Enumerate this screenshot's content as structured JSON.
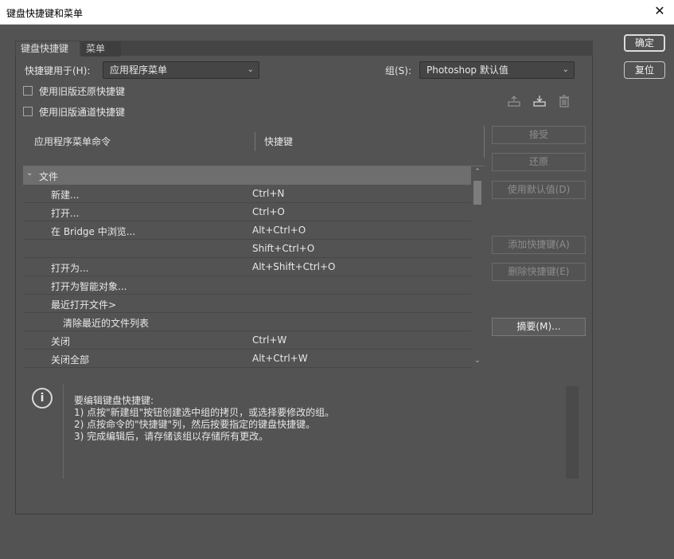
{
  "window": {
    "title": "键盘快捷键和菜单",
    "close_glyph": "✕"
  },
  "tabs": [
    {
      "label": "键盘快捷键"
    },
    {
      "label": "菜单"
    }
  ],
  "shortcuts_for": {
    "label": "快捷键用于(H):",
    "value": "应用程序菜单"
  },
  "set": {
    "label": "组(S):",
    "value": "Photoshop 默认值"
  },
  "checkboxes": [
    {
      "label": "使用旧版还原快捷键",
      "checked": false
    },
    {
      "label": "使用旧版通道快捷键",
      "checked": false
    }
  ],
  "icons": [
    "save-set-icon",
    "new-set-icon",
    "delete-set-icon"
  ],
  "table": {
    "col_command": "应用程序菜单命令",
    "col_shortcut": "快捷键",
    "group": "文件",
    "rows": [
      {
        "cmd": "新建...",
        "key": "Ctrl+N",
        "indent": 1
      },
      {
        "cmd": "打开...",
        "key": "Ctrl+O",
        "indent": 1
      },
      {
        "cmd": "在 Bridge 中浏览...",
        "key": "Alt+Ctrl+O",
        "indent": 1
      },
      {
        "cmd": "",
        "key": "Shift+Ctrl+O",
        "indent": 1
      },
      {
        "cmd": "打开为...",
        "key": "Alt+Shift+Ctrl+O",
        "indent": 1
      },
      {
        "cmd": "打开为智能对象...",
        "key": "",
        "indent": 1
      },
      {
        "cmd": "最近打开文件>",
        "key": "",
        "indent": 1
      },
      {
        "cmd": "清除最近的文件列表",
        "key": "",
        "indent": 2
      },
      {
        "cmd": "关闭",
        "key": "Ctrl+W",
        "indent": 1
      },
      {
        "cmd": "关闭全部",
        "key": "Alt+Ctrl+W",
        "indent": 1
      }
    ]
  },
  "side_buttons": {
    "accept": "接受",
    "undo": "还原",
    "use_default": "使用默认值(D)",
    "add_shortcut": "添加快捷键(A)",
    "delete_shortcut": "删除快捷键(E)",
    "summarize": "摘要(M)..."
  },
  "dialog_buttons": {
    "ok": "确定",
    "reset": "复位"
  },
  "info": {
    "lines": [
      "要编辑键盘快捷键:",
      "1) 点按\"新建组\"按钮创建选中组的拷贝，或选择要修改的组。",
      "2) 点按命令的\"快捷键\"列，然后按要指定的键盘快捷键。",
      "3) 完成编辑后，请存储该组以存储所有更改。"
    ]
  }
}
